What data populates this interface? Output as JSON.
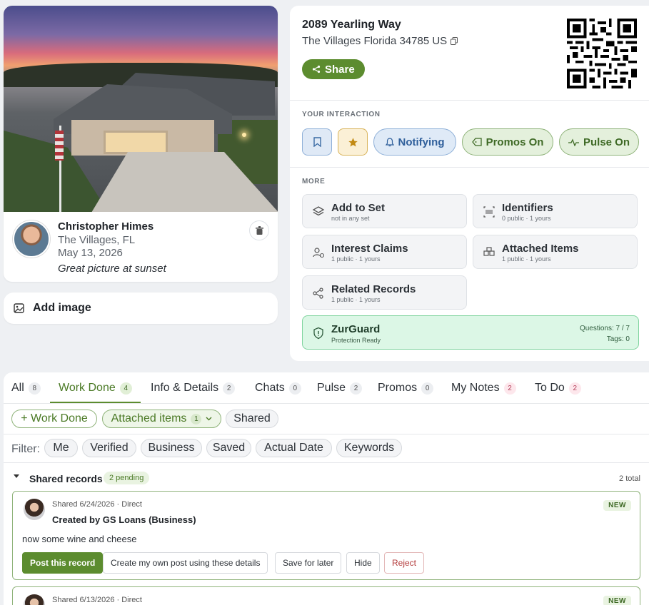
{
  "photo": {
    "author_name": "Christopher Himes",
    "author_location": "The Villages, FL",
    "author_date": "May 13, 2026",
    "caption": "Great picture at sunset"
  },
  "add_image": {
    "label": "Add image"
  },
  "property": {
    "title": "2089 Yearling Way",
    "address": "The Villages Florida 34785 US",
    "share_label": "Share"
  },
  "interaction": {
    "label": "YOUR INTERACTION",
    "notifying": "Notifying",
    "promos": "Promos On",
    "pulse": "Pulse On"
  },
  "more": {
    "label": "MORE",
    "items": [
      {
        "title": "Add to Set",
        "sub": "not in any set"
      },
      {
        "title": "Identifiers",
        "sub": "0 public · 1 yours"
      },
      {
        "title": "Interest Claims",
        "sub": "1 public · 1 yours"
      },
      {
        "title": "Attached Items",
        "sub": "1 public · 1 yours"
      },
      {
        "title": "Related Records",
        "sub": "1 public · 1 yours"
      }
    ],
    "zurguard": {
      "title": "ZurGuard",
      "sub": "Protection Ready",
      "questions": "Questions: 7 / 7",
      "tags": "Tags: 0"
    }
  },
  "tabs": [
    {
      "label": "All",
      "count": "8"
    },
    {
      "label": "Work Done",
      "count": "4"
    },
    {
      "label": "Info & Details",
      "count": "2"
    },
    {
      "label": "Chats",
      "count": "0"
    },
    {
      "label": "Pulse",
      "count": "2"
    },
    {
      "label": "Promos",
      "count": "0"
    },
    {
      "label": "My Notes",
      "count": "2"
    },
    {
      "label": "To Do",
      "count": "2"
    }
  ],
  "chips": {
    "add_work": "+ Work Done",
    "attached": "Attached items",
    "attached_count": "1",
    "shared": "Shared"
  },
  "filters": {
    "label": "Filter:",
    "items": [
      "Me",
      "Verified",
      "Business",
      "Saved",
      "Actual Date",
      "Keywords"
    ]
  },
  "shared_records": {
    "title": "Shared records",
    "pending": "2 pending",
    "total": "2 total",
    "records": [
      {
        "meta": "Shared 6/24/2026 · Direct",
        "by": "Created by GS Loans (Business)",
        "message": "now some wine and cheese",
        "badge": "NEW"
      },
      {
        "meta": "Shared 6/13/2026 · Direct",
        "badge": "NEW"
      }
    ],
    "actions": {
      "post": "Post this record",
      "create": "Create my own post using these details",
      "save": "Save for later",
      "hide": "Hide",
      "reject": "Reject"
    }
  },
  "colors": {
    "brand_green": "#5c8c2f",
    "accent_blue": "#2f5f9b",
    "zurguard_bg": "#dcf7e6"
  }
}
